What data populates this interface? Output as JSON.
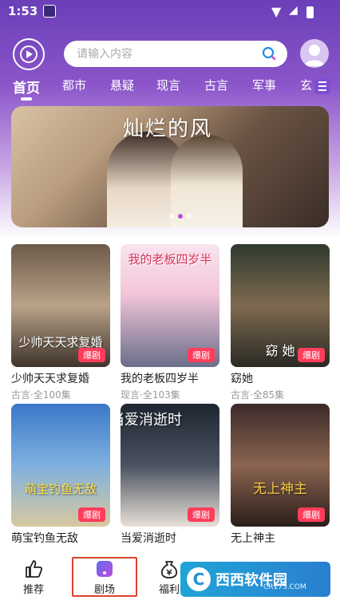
{
  "status": {
    "time": "1:53"
  },
  "search": {
    "placeholder": "请输入内容"
  },
  "tabs": [
    "首页",
    "都市",
    "悬疑",
    "现言",
    "古言",
    "军事",
    "玄"
  ],
  "banner": {
    "title": "灿烂的风"
  },
  "dramas": [
    {
      "title": "少帅天天求复婚",
      "sub": "古言·全100集",
      "badge": "爆剧",
      "poster_text": "少帅天天求复婚"
    },
    {
      "title": "我的老板四岁半",
      "sub": "现言·全103集",
      "badge": "爆剧",
      "poster_text": "我的老板四岁半"
    },
    {
      "title": "窈她",
      "sub": "古言·全85集",
      "badge": "爆剧",
      "poster_text": "窈 她"
    },
    {
      "title": "萌宝钓鱼无敌",
      "sub": "",
      "badge": "爆剧",
      "poster_text": "萌宝钓鱼无敌"
    },
    {
      "title": "当爱消逝时",
      "sub": "",
      "badge": "爆剧",
      "poster_text": "当爱消逝时"
    },
    {
      "title": "无上神主",
      "sub": "",
      "badge": "爆剧",
      "poster_text": "无上神主"
    }
  ],
  "nav": {
    "recommend": "推荐",
    "theater": "剧场",
    "welfare": "福利"
  },
  "watermark": {
    "name": "西西软件园",
    "url": "CR173.COM"
  },
  "colors": {
    "accent": "#7d4ed6",
    "badge": "#ff3c5a",
    "highlight": "#d9442b"
  }
}
